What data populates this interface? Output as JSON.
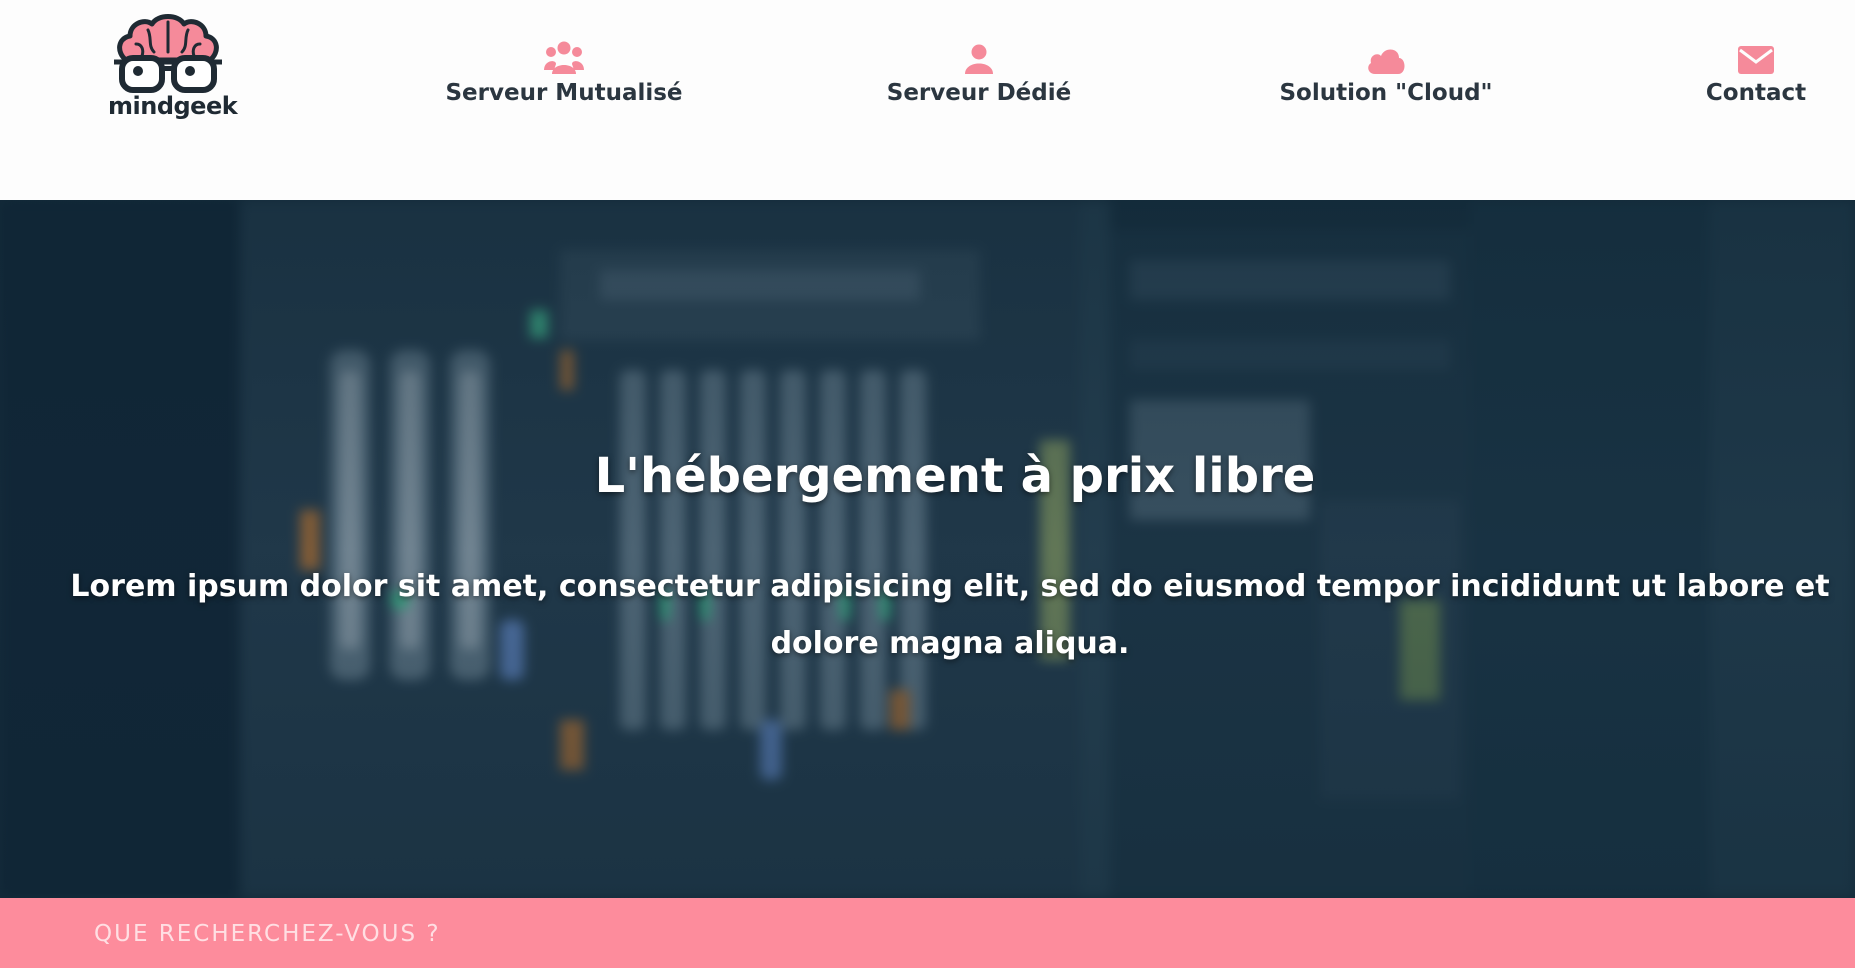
{
  "brand": {
    "name": "mindgeek"
  },
  "nav": [
    {
      "id": "mutualise",
      "label": "Serveur Mutualisé",
      "icon": "users-icon"
    },
    {
      "id": "dedie",
      "label": "Serveur Dédié",
      "icon": "user-icon"
    },
    {
      "id": "cloud",
      "label": "Solution \"Cloud\"",
      "icon": "cloud-icon"
    },
    {
      "id": "contact",
      "label": "Contact",
      "icon": "envelope-icon"
    }
  ],
  "hero": {
    "title": "L'hébergement à prix libre",
    "text": "Lorem ipsum dolor sit amet, consectetur adipisicing elit, sed do eiusmod tempor incididunt ut labore et dolore magna aliqua."
  },
  "search": {
    "placeholder": "QUE RECHERCHEZ-VOUS ?"
  },
  "colors": {
    "accent": "#f58a9a",
    "header_text": "#2b3640",
    "search_bar": "#fd8c9c",
    "hero_tint": "#1b3140"
  }
}
